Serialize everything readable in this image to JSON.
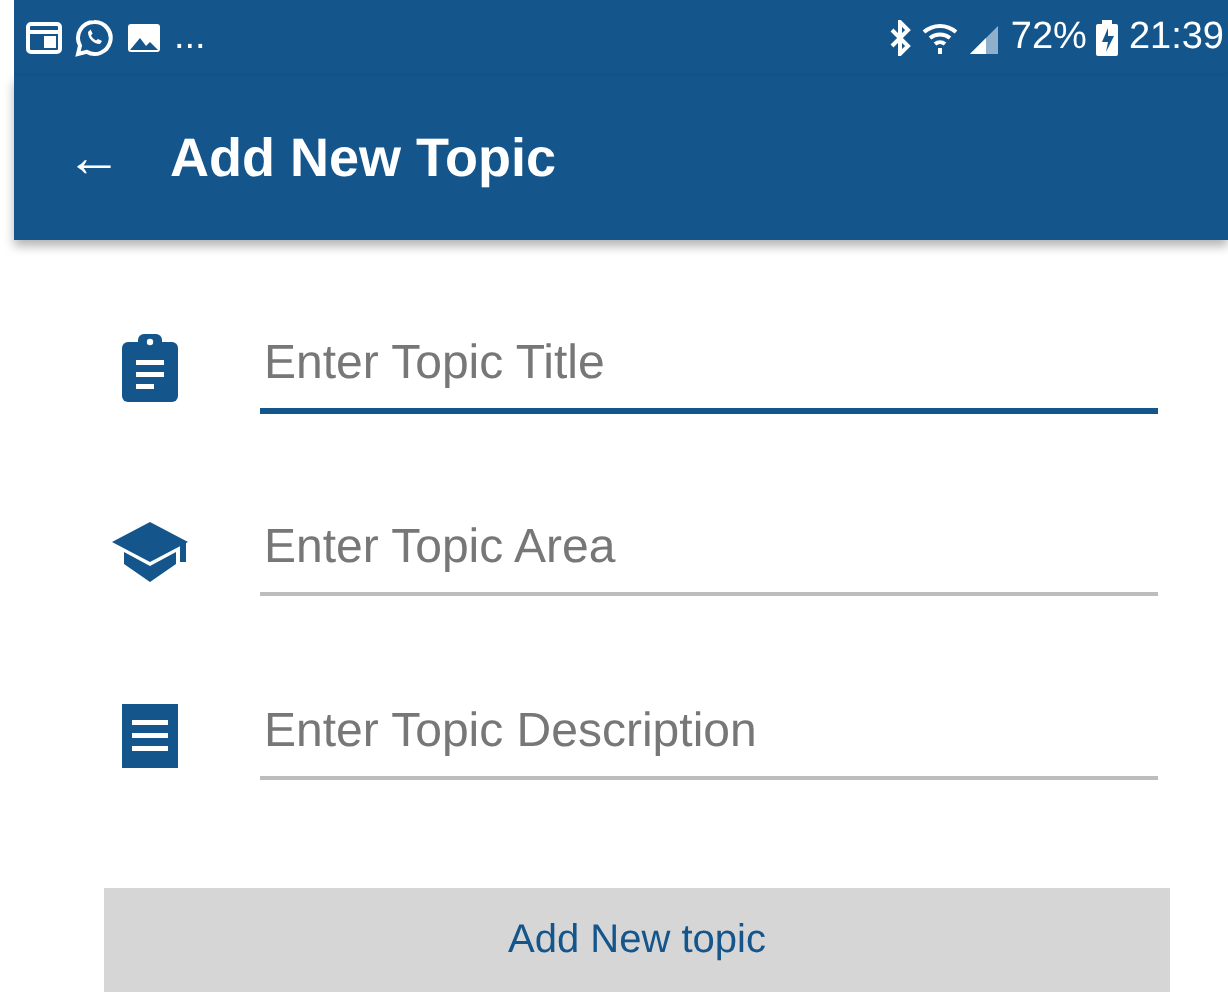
{
  "status_bar": {
    "notifications_more": "...",
    "battery_percent": "72%",
    "time": "21:39"
  },
  "app_bar": {
    "back_icon": "←",
    "title": "Add New Topic"
  },
  "fields": [
    {
      "kind": "clipboard",
      "placeholder": "Enter Topic Title",
      "focused": true
    },
    {
      "kind": "cap",
      "placeholder": "Enter Topic Area",
      "focused": false
    },
    {
      "kind": "receipt",
      "placeholder": "Enter Topic Description",
      "focused": false
    }
  ],
  "submit_button": {
    "label": "Add New topic"
  }
}
